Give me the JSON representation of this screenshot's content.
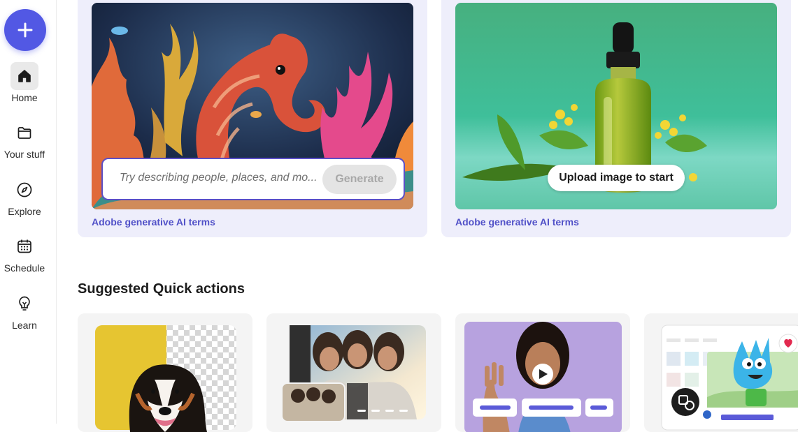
{
  "nav": {
    "create_icon": "plus-icon",
    "items": [
      {
        "label": "Home",
        "icon": "home-icon",
        "active": true
      },
      {
        "label": "Your stuff",
        "icon": "folder-icon"
      },
      {
        "label": "Explore",
        "icon": "compass-icon"
      },
      {
        "label": "Schedule",
        "icon": "calendar-icon"
      },
      {
        "label": "Learn",
        "icon": "lightbulb-icon"
      }
    ]
  },
  "text_to_image": {
    "prompt_placeholder": "Try describing people, places, and mo...",
    "generate_label": "Generate",
    "terms_link": "Adobe generative AI terms"
  },
  "generative_fill": {
    "upload_label": "Upload image to start",
    "terms_link": "Adobe generative AI terms"
  },
  "quick_actions": {
    "title": "Suggested Quick actions"
  },
  "colors": {
    "accent": "#5258e4",
    "link": "#5151c8",
    "card_bg": "#eeeefb"
  }
}
